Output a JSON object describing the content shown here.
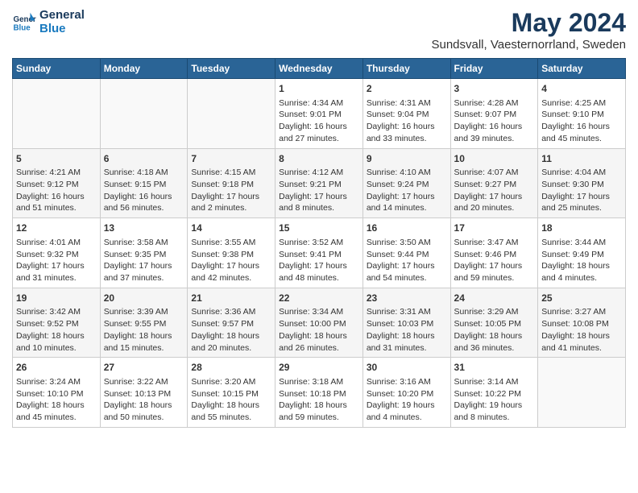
{
  "logo": {
    "line1": "General",
    "line2": "Blue"
  },
  "title": "May 2024",
  "subtitle": "Sundsvall, Vaesternorrland, Sweden",
  "headers": [
    "Sunday",
    "Monday",
    "Tuesday",
    "Wednesday",
    "Thursday",
    "Friday",
    "Saturday"
  ],
  "weeks": [
    [
      {
        "day": "",
        "info": ""
      },
      {
        "day": "",
        "info": ""
      },
      {
        "day": "",
        "info": ""
      },
      {
        "day": "1",
        "info": "Sunrise: 4:34 AM\nSunset: 9:01 PM\nDaylight: 16 hours\nand 27 minutes."
      },
      {
        "day": "2",
        "info": "Sunrise: 4:31 AM\nSunset: 9:04 PM\nDaylight: 16 hours\nand 33 minutes."
      },
      {
        "day": "3",
        "info": "Sunrise: 4:28 AM\nSunset: 9:07 PM\nDaylight: 16 hours\nand 39 minutes."
      },
      {
        "day": "4",
        "info": "Sunrise: 4:25 AM\nSunset: 9:10 PM\nDaylight: 16 hours\nand 45 minutes."
      }
    ],
    [
      {
        "day": "5",
        "info": "Sunrise: 4:21 AM\nSunset: 9:12 PM\nDaylight: 16 hours\nand 51 minutes."
      },
      {
        "day": "6",
        "info": "Sunrise: 4:18 AM\nSunset: 9:15 PM\nDaylight: 16 hours\nand 56 minutes."
      },
      {
        "day": "7",
        "info": "Sunrise: 4:15 AM\nSunset: 9:18 PM\nDaylight: 17 hours\nand 2 minutes."
      },
      {
        "day": "8",
        "info": "Sunrise: 4:12 AM\nSunset: 9:21 PM\nDaylight: 17 hours\nand 8 minutes."
      },
      {
        "day": "9",
        "info": "Sunrise: 4:10 AM\nSunset: 9:24 PM\nDaylight: 17 hours\nand 14 minutes."
      },
      {
        "day": "10",
        "info": "Sunrise: 4:07 AM\nSunset: 9:27 PM\nDaylight: 17 hours\nand 20 minutes."
      },
      {
        "day": "11",
        "info": "Sunrise: 4:04 AM\nSunset: 9:30 PM\nDaylight: 17 hours\nand 25 minutes."
      }
    ],
    [
      {
        "day": "12",
        "info": "Sunrise: 4:01 AM\nSunset: 9:32 PM\nDaylight: 17 hours\nand 31 minutes."
      },
      {
        "day": "13",
        "info": "Sunrise: 3:58 AM\nSunset: 9:35 PM\nDaylight: 17 hours\nand 37 minutes."
      },
      {
        "day": "14",
        "info": "Sunrise: 3:55 AM\nSunset: 9:38 PM\nDaylight: 17 hours\nand 42 minutes."
      },
      {
        "day": "15",
        "info": "Sunrise: 3:52 AM\nSunset: 9:41 PM\nDaylight: 17 hours\nand 48 minutes."
      },
      {
        "day": "16",
        "info": "Sunrise: 3:50 AM\nSunset: 9:44 PM\nDaylight: 17 hours\nand 54 minutes."
      },
      {
        "day": "17",
        "info": "Sunrise: 3:47 AM\nSunset: 9:46 PM\nDaylight: 17 hours\nand 59 minutes."
      },
      {
        "day": "18",
        "info": "Sunrise: 3:44 AM\nSunset: 9:49 PM\nDaylight: 18 hours\nand 4 minutes."
      }
    ],
    [
      {
        "day": "19",
        "info": "Sunrise: 3:42 AM\nSunset: 9:52 PM\nDaylight: 18 hours\nand 10 minutes."
      },
      {
        "day": "20",
        "info": "Sunrise: 3:39 AM\nSunset: 9:55 PM\nDaylight: 18 hours\nand 15 minutes."
      },
      {
        "day": "21",
        "info": "Sunrise: 3:36 AM\nSunset: 9:57 PM\nDaylight: 18 hours\nand 20 minutes."
      },
      {
        "day": "22",
        "info": "Sunrise: 3:34 AM\nSunset: 10:00 PM\nDaylight: 18 hours\nand 26 minutes."
      },
      {
        "day": "23",
        "info": "Sunrise: 3:31 AM\nSunset: 10:03 PM\nDaylight: 18 hours\nand 31 minutes."
      },
      {
        "day": "24",
        "info": "Sunrise: 3:29 AM\nSunset: 10:05 PM\nDaylight: 18 hours\nand 36 minutes."
      },
      {
        "day": "25",
        "info": "Sunrise: 3:27 AM\nSunset: 10:08 PM\nDaylight: 18 hours\nand 41 minutes."
      }
    ],
    [
      {
        "day": "26",
        "info": "Sunrise: 3:24 AM\nSunset: 10:10 PM\nDaylight: 18 hours\nand 45 minutes."
      },
      {
        "day": "27",
        "info": "Sunrise: 3:22 AM\nSunset: 10:13 PM\nDaylight: 18 hours\nand 50 minutes."
      },
      {
        "day": "28",
        "info": "Sunrise: 3:20 AM\nSunset: 10:15 PM\nDaylight: 18 hours\nand 55 minutes."
      },
      {
        "day": "29",
        "info": "Sunrise: 3:18 AM\nSunset: 10:18 PM\nDaylight: 18 hours\nand 59 minutes."
      },
      {
        "day": "30",
        "info": "Sunrise: 3:16 AM\nSunset: 10:20 PM\nDaylight: 19 hours\nand 4 minutes."
      },
      {
        "day": "31",
        "info": "Sunrise: 3:14 AM\nSunset: 10:22 PM\nDaylight: 19 hours\nand 8 minutes."
      },
      {
        "day": "",
        "info": ""
      }
    ]
  ]
}
